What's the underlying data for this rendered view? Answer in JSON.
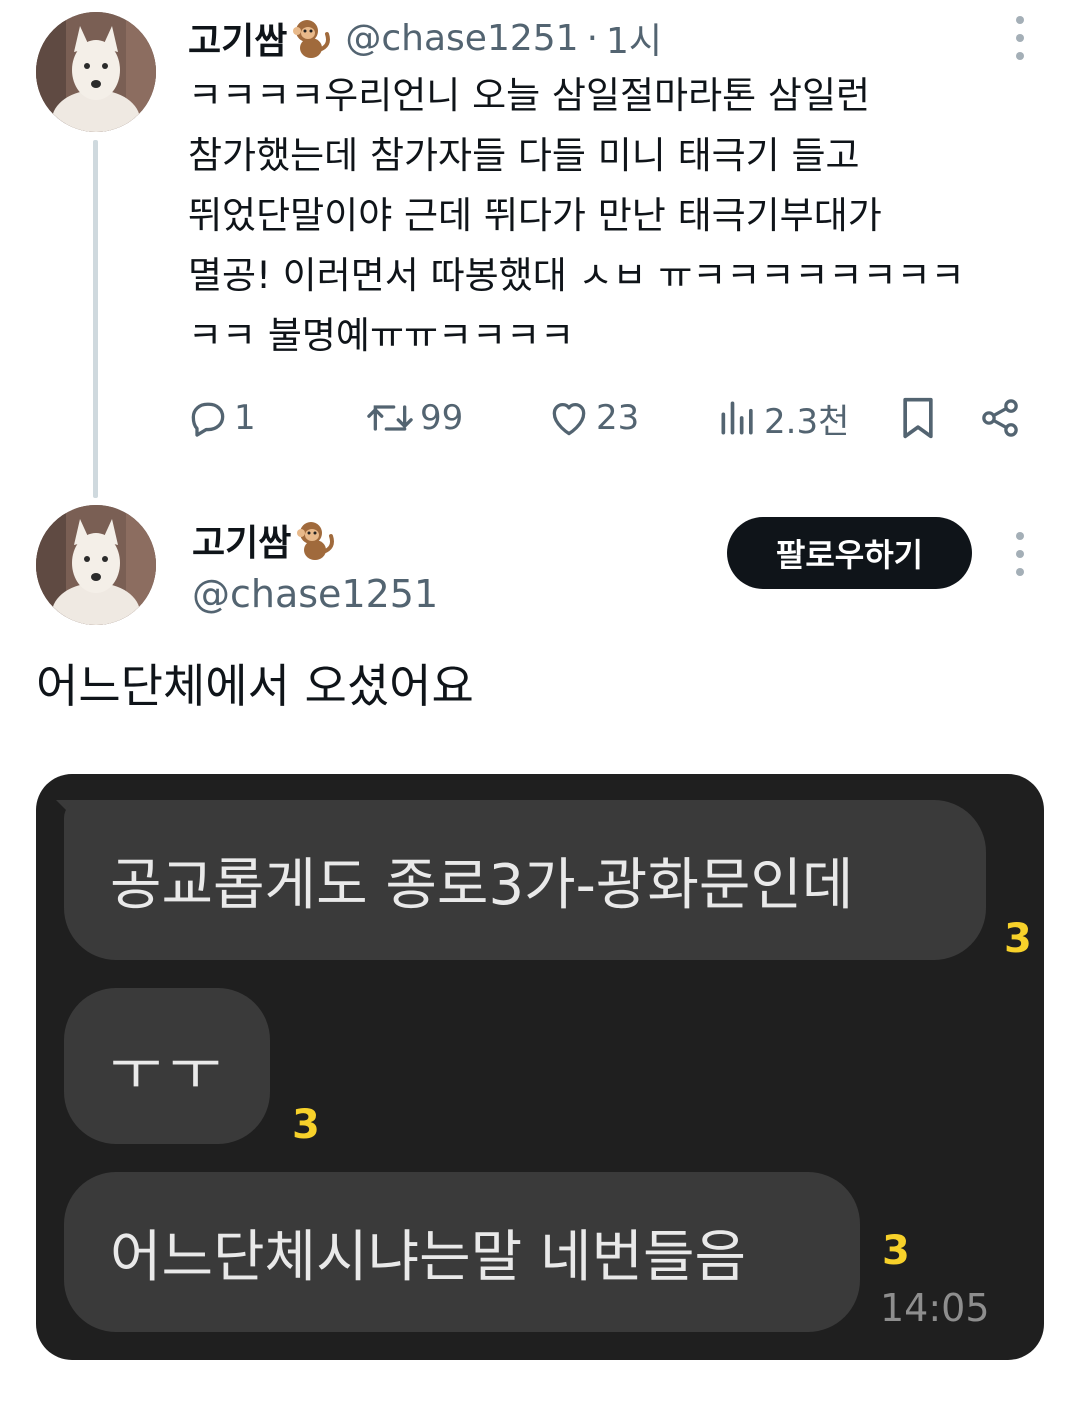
{
  "parent_tweet": {
    "display_name": "고기쌈",
    "handle": "@chase1251",
    "separator": "·",
    "time": "1시",
    "text_lines": [
      "ㅋㅋㅋㅋ우리언니 오늘 삼일절마라톤 삼일런",
      "참가했는데 참가자들 다들 미니 태극기 들고",
      "뛰었단말이야 근데 뛰다가 만난 태극기부대가",
      "멸공! 이러면서 따봉했대 ㅅㅂ ㅠㅋㅋㅋㅋㅋㅋㅋㅋ",
      "ㅋㅋ 불명예ㅠㅠㅋㅋㅋㅋ"
    ],
    "stats": {
      "replies": "1",
      "retweets": "99",
      "likes": "23",
      "views": "2.3천"
    }
  },
  "main_tweet": {
    "display_name": "고기쌈",
    "handle": "@chase1251",
    "follow_label": "팔로우하기",
    "text": "어느단체에서 오셨어요"
  },
  "chat_image": {
    "messages": [
      {
        "text": "공교롭게도 종로3가-광화문인데",
        "unread": "3"
      },
      {
        "text": "ㅜㅜ",
        "unread": "3"
      },
      {
        "text": "어느단체시냐는말 네번들음",
        "unread": "3"
      }
    ],
    "time": "14:05"
  },
  "colors": {
    "text_primary": "#0f1419",
    "text_secondary": "#536471",
    "follow_button_bg": "#0f1419",
    "chat_bg": "#1f1f1f",
    "bubble_bg": "#3a3a3a",
    "unread_count": "#f7d12a"
  },
  "icons": {
    "name_emoji": "monkey-emoji",
    "reply": "reply-icon",
    "retweet": "retweet-icon",
    "like": "heart-icon",
    "views": "views-icon",
    "bookmark": "bookmark-icon",
    "share": "share-icon",
    "more": "more-vertical-icon"
  }
}
